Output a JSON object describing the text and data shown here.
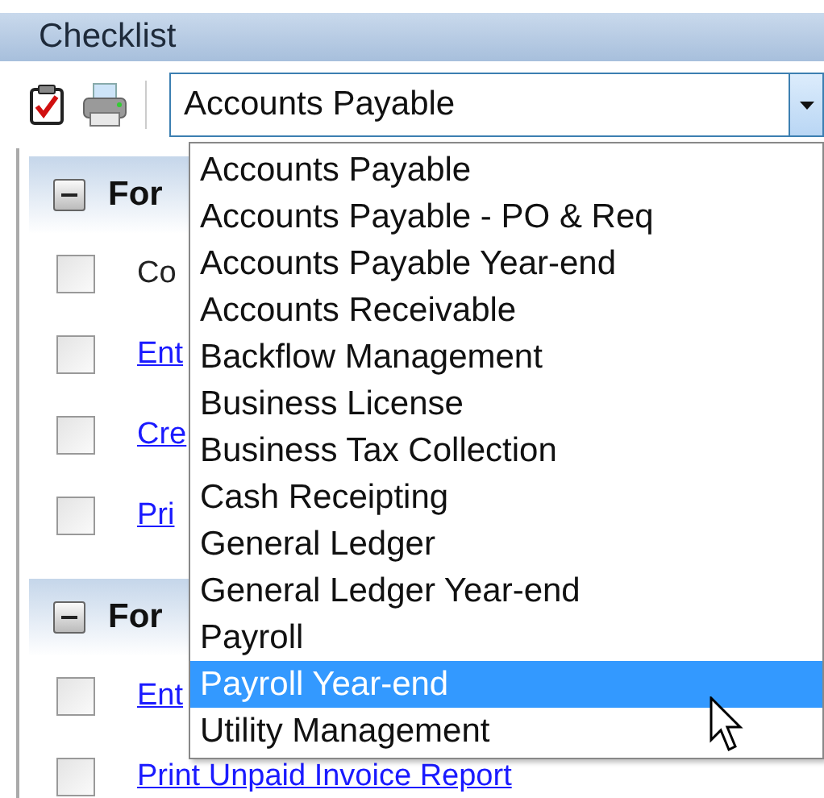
{
  "panel": {
    "title": "Checklist"
  },
  "combo": {
    "value": "Accounts Payable",
    "expanded": true
  },
  "dropdown": {
    "items": [
      {
        "label": "Accounts Payable",
        "selected": false
      },
      {
        "label": "Accounts Payable - PO & Req",
        "selected": false
      },
      {
        "label": "Accounts Payable Year-end",
        "selected": false
      },
      {
        "label": "Accounts Receivable",
        "selected": false
      },
      {
        "label": "Backflow Management",
        "selected": false
      },
      {
        "label": "Business License",
        "selected": false
      },
      {
        "label": "Business Tax Collection",
        "selected": false
      },
      {
        "label": "Cash Receipting",
        "selected": false
      },
      {
        "label": "General Ledger",
        "selected": false
      },
      {
        "label": "General Ledger Year-end",
        "selected": false
      },
      {
        "label": "Payroll",
        "selected": false
      },
      {
        "label": "Payroll Year-end",
        "selected": true
      },
      {
        "label": "Utility Management",
        "selected": false
      }
    ]
  },
  "groups": [
    {
      "title": "For",
      "expanded": true,
      "items": [
        {
          "label": "Co",
          "kind": "text",
          "checked": false
        },
        {
          "label": "Ent",
          "kind": "link",
          "checked": false
        },
        {
          "label": "Cre",
          "kind": "link",
          "checked": false
        },
        {
          "label": "Pri",
          "kind": "link",
          "checked": false
        }
      ]
    },
    {
      "title": "For",
      "expanded": true,
      "items": [
        {
          "label": "Ent",
          "kind": "link",
          "checked": false
        },
        {
          "label": "Print Unpaid Invoice Report",
          "kind": "link",
          "checked": false
        }
      ]
    }
  ]
}
